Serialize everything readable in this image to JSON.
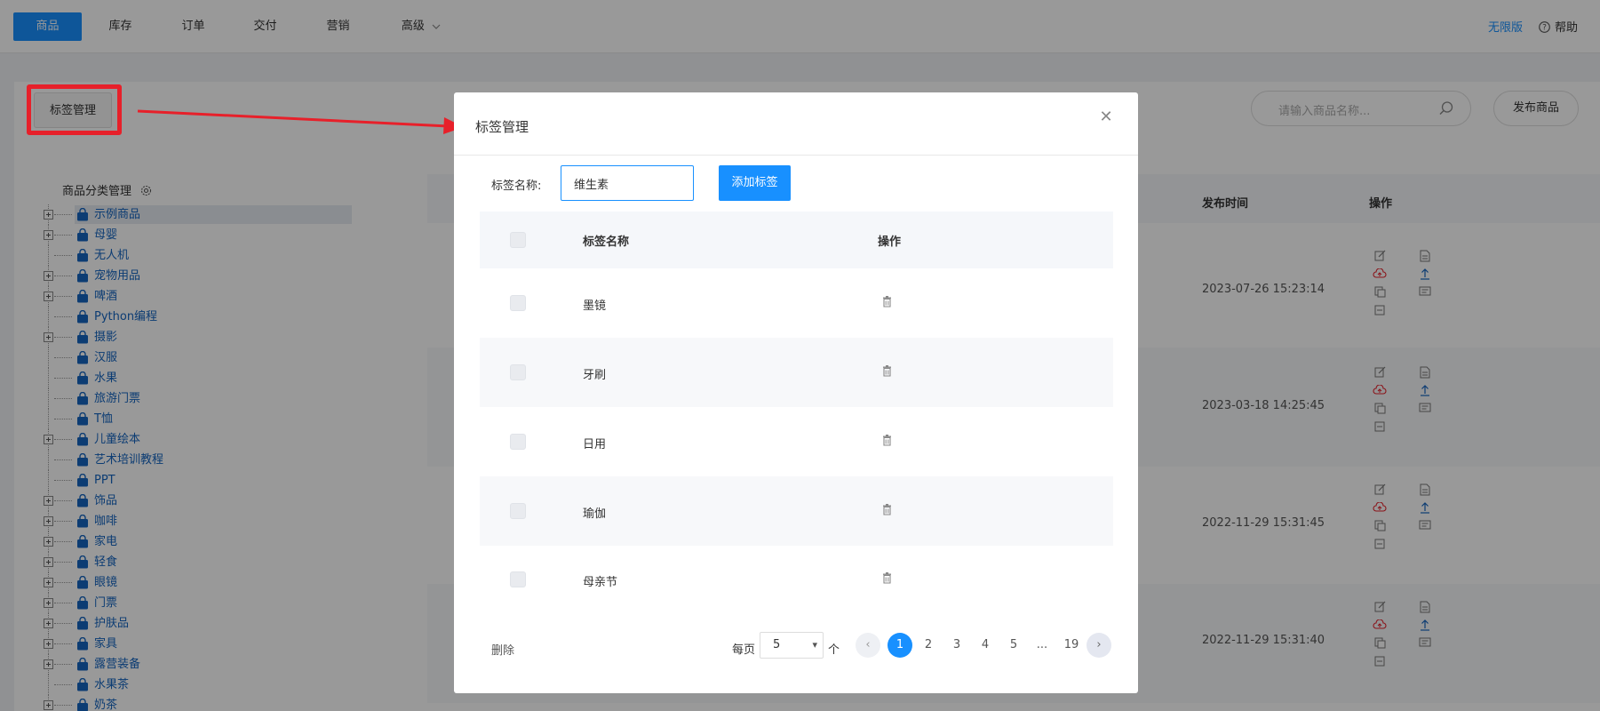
{
  "nav": {
    "tabs": [
      {
        "label": "商品",
        "active": true
      },
      {
        "label": "库存"
      },
      {
        "label": "订单"
      },
      {
        "label": "交付"
      },
      {
        "label": "营销"
      },
      {
        "label": "高级"
      }
    ],
    "edition": "无限版",
    "help": "帮助"
  },
  "toolbar": {
    "tag_mgmt_label": "标签管理",
    "search_placeholder": "请输入商品名称...",
    "publish_label": "发布商品"
  },
  "category": {
    "title": "商品分类管理",
    "items": [
      {
        "label": "示例商品",
        "expandable": true,
        "selected": true
      },
      {
        "label": "母婴",
        "expandable": true
      },
      {
        "label": "无人机",
        "expandable": false
      },
      {
        "label": "宠物用品",
        "expandable": true
      },
      {
        "label": "啤酒",
        "expandable": true
      },
      {
        "label": "Python编程",
        "expandable": false
      },
      {
        "label": "摄影",
        "expandable": true
      },
      {
        "label": "汉服",
        "expandable": false
      },
      {
        "label": "水果",
        "expandable": false
      },
      {
        "label": "旅游门票",
        "expandable": false
      },
      {
        "label": "T恤",
        "expandable": false
      },
      {
        "label": "儿童绘本",
        "expandable": true
      },
      {
        "label": "艺术培训教程",
        "expandable": false
      },
      {
        "label": "PPT",
        "expandable": false
      },
      {
        "label": "饰品",
        "expandable": true
      },
      {
        "label": "咖啡",
        "expandable": true
      },
      {
        "label": "家电",
        "expandable": true
      },
      {
        "label": "轻食",
        "expandable": true
      },
      {
        "label": "眼镜",
        "expandable": true
      },
      {
        "label": "门票",
        "expandable": true
      },
      {
        "label": "护肤品",
        "expandable": true
      },
      {
        "label": "家具",
        "expandable": true
      },
      {
        "label": "露营装备",
        "expandable": true
      },
      {
        "label": "水果茶",
        "expandable": false
      },
      {
        "label": "奶茶",
        "expandable": true
      }
    ]
  },
  "products_table": {
    "col_publish_time": "发布时间",
    "col_ops": "操作",
    "rows": [
      {
        "time": "2023-07-26 15:23:14"
      },
      {
        "time": "2023-03-18 14:25:45"
      },
      {
        "time": "2022-11-29 15:31:45"
      },
      {
        "time": "2022-11-29 15:31:40"
      }
    ]
  },
  "modal": {
    "title": "标签管理",
    "field_label": "标签名称:",
    "input_value": "维生素",
    "add_button": "添加标签",
    "table": {
      "col_name": "标签名称",
      "col_op": "操作",
      "rows": [
        {
          "name": "墨镜"
        },
        {
          "name": "牙刷"
        },
        {
          "name": "日用"
        },
        {
          "name": "瑜伽"
        },
        {
          "name": "母亲节"
        }
      ]
    },
    "delete_label": "删除",
    "pagination": {
      "per_page_label": "每页",
      "per_page_value": "5",
      "per_page_unit": "个",
      "pages": [
        "1",
        "2",
        "3",
        "4",
        "5",
        "...",
        "19"
      ],
      "current": "1"
    }
  },
  "colors": {
    "primary": "#1890ff",
    "annotation": "#e7202a",
    "tree_text": "#1565c0"
  }
}
